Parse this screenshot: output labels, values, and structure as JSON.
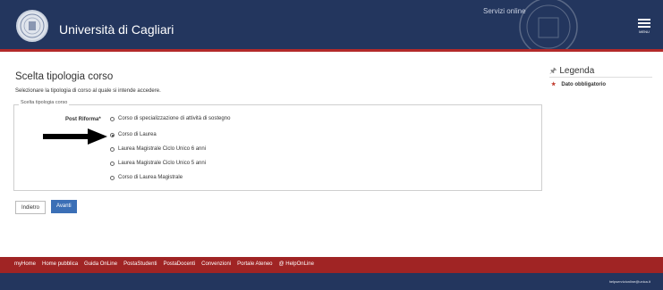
{
  "header": {
    "university": "Università di Cagliari",
    "servizi": "Servizi online",
    "menu_label": "MENU"
  },
  "main": {
    "title": "Scelta tipologia corso",
    "subtitle": "Selezionare la tipologia di corso al quale si intende accedere.",
    "fieldset_legend": "Scelta tipologia corso",
    "field_label": "Post Riforma*",
    "options": [
      "Corso di specializzazione di attività di sostegno",
      "Corso di Laurea",
      "Laurea Magistrale Ciclo Unico 6 anni",
      "Laurea Magistrale Ciclo Unico 5 anni",
      "Corso di Laurea Magistrale"
    ],
    "selected_index": 1,
    "back_button": "Indietro",
    "next_button": "Avanti"
  },
  "sidebar": {
    "legend_title": "Legenda",
    "required_label": "Dato obbligatorio"
  },
  "footer": {
    "links": [
      "myHome",
      "Home pubblica",
      "Guida OnLine",
      "PostaStudenti",
      "PostaDocenti",
      "Convenzioni",
      "Portale Ateneo",
      "@ HelpOnLine"
    ],
    "help_email": "helpservizionline@unica.it"
  },
  "colors": {
    "header_bg": "#23365e",
    "accent_red": "#b32a2a",
    "footer_red": "#a02424",
    "button_blue": "#3b6fb6"
  }
}
